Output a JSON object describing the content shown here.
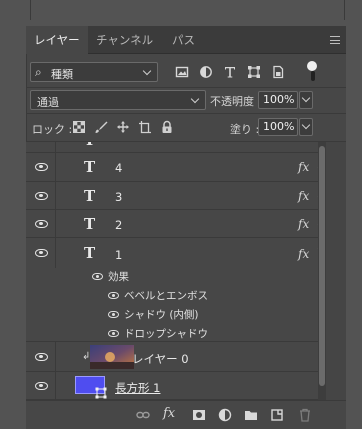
{
  "tabs": [
    {
      "label": "レイヤー",
      "active": true
    },
    {
      "label": "チャンネル",
      "active": false
    },
    {
      "label": "パス",
      "active": false
    }
  ],
  "filter": {
    "kind_label": "種類"
  },
  "blend": {
    "mode": "通過",
    "opacity_label": "不透明度 :",
    "opacity_value": "100%"
  },
  "lock": {
    "label": "ロック :",
    "fill_label": "塗り :",
    "fill_value": "100%"
  },
  "layers": [
    {
      "name": "4",
      "type": "text",
      "fx": "fx"
    },
    {
      "name": "3",
      "type": "text",
      "fx": "fx"
    },
    {
      "name": "2",
      "type": "text",
      "fx": "fx"
    },
    {
      "name": "1",
      "type": "text",
      "fx": "fx"
    },
    {
      "name": "レイヤー 0",
      "type": "image"
    },
    {
      "name": "長方形 1",
      "type": "shape"
    }
  ],
  "effects": {
    "header": "効果",
    "items": [
      "ベベルとエンボス",
      "シャドウ (内側)",
      "ドロップシャドウ"
    ]
  },
  "colors": {
    "panel": "#474747",
    "shape_fill": "#4f4df0",
    "accent_thumb": "#6b6b6b"
  }
}
